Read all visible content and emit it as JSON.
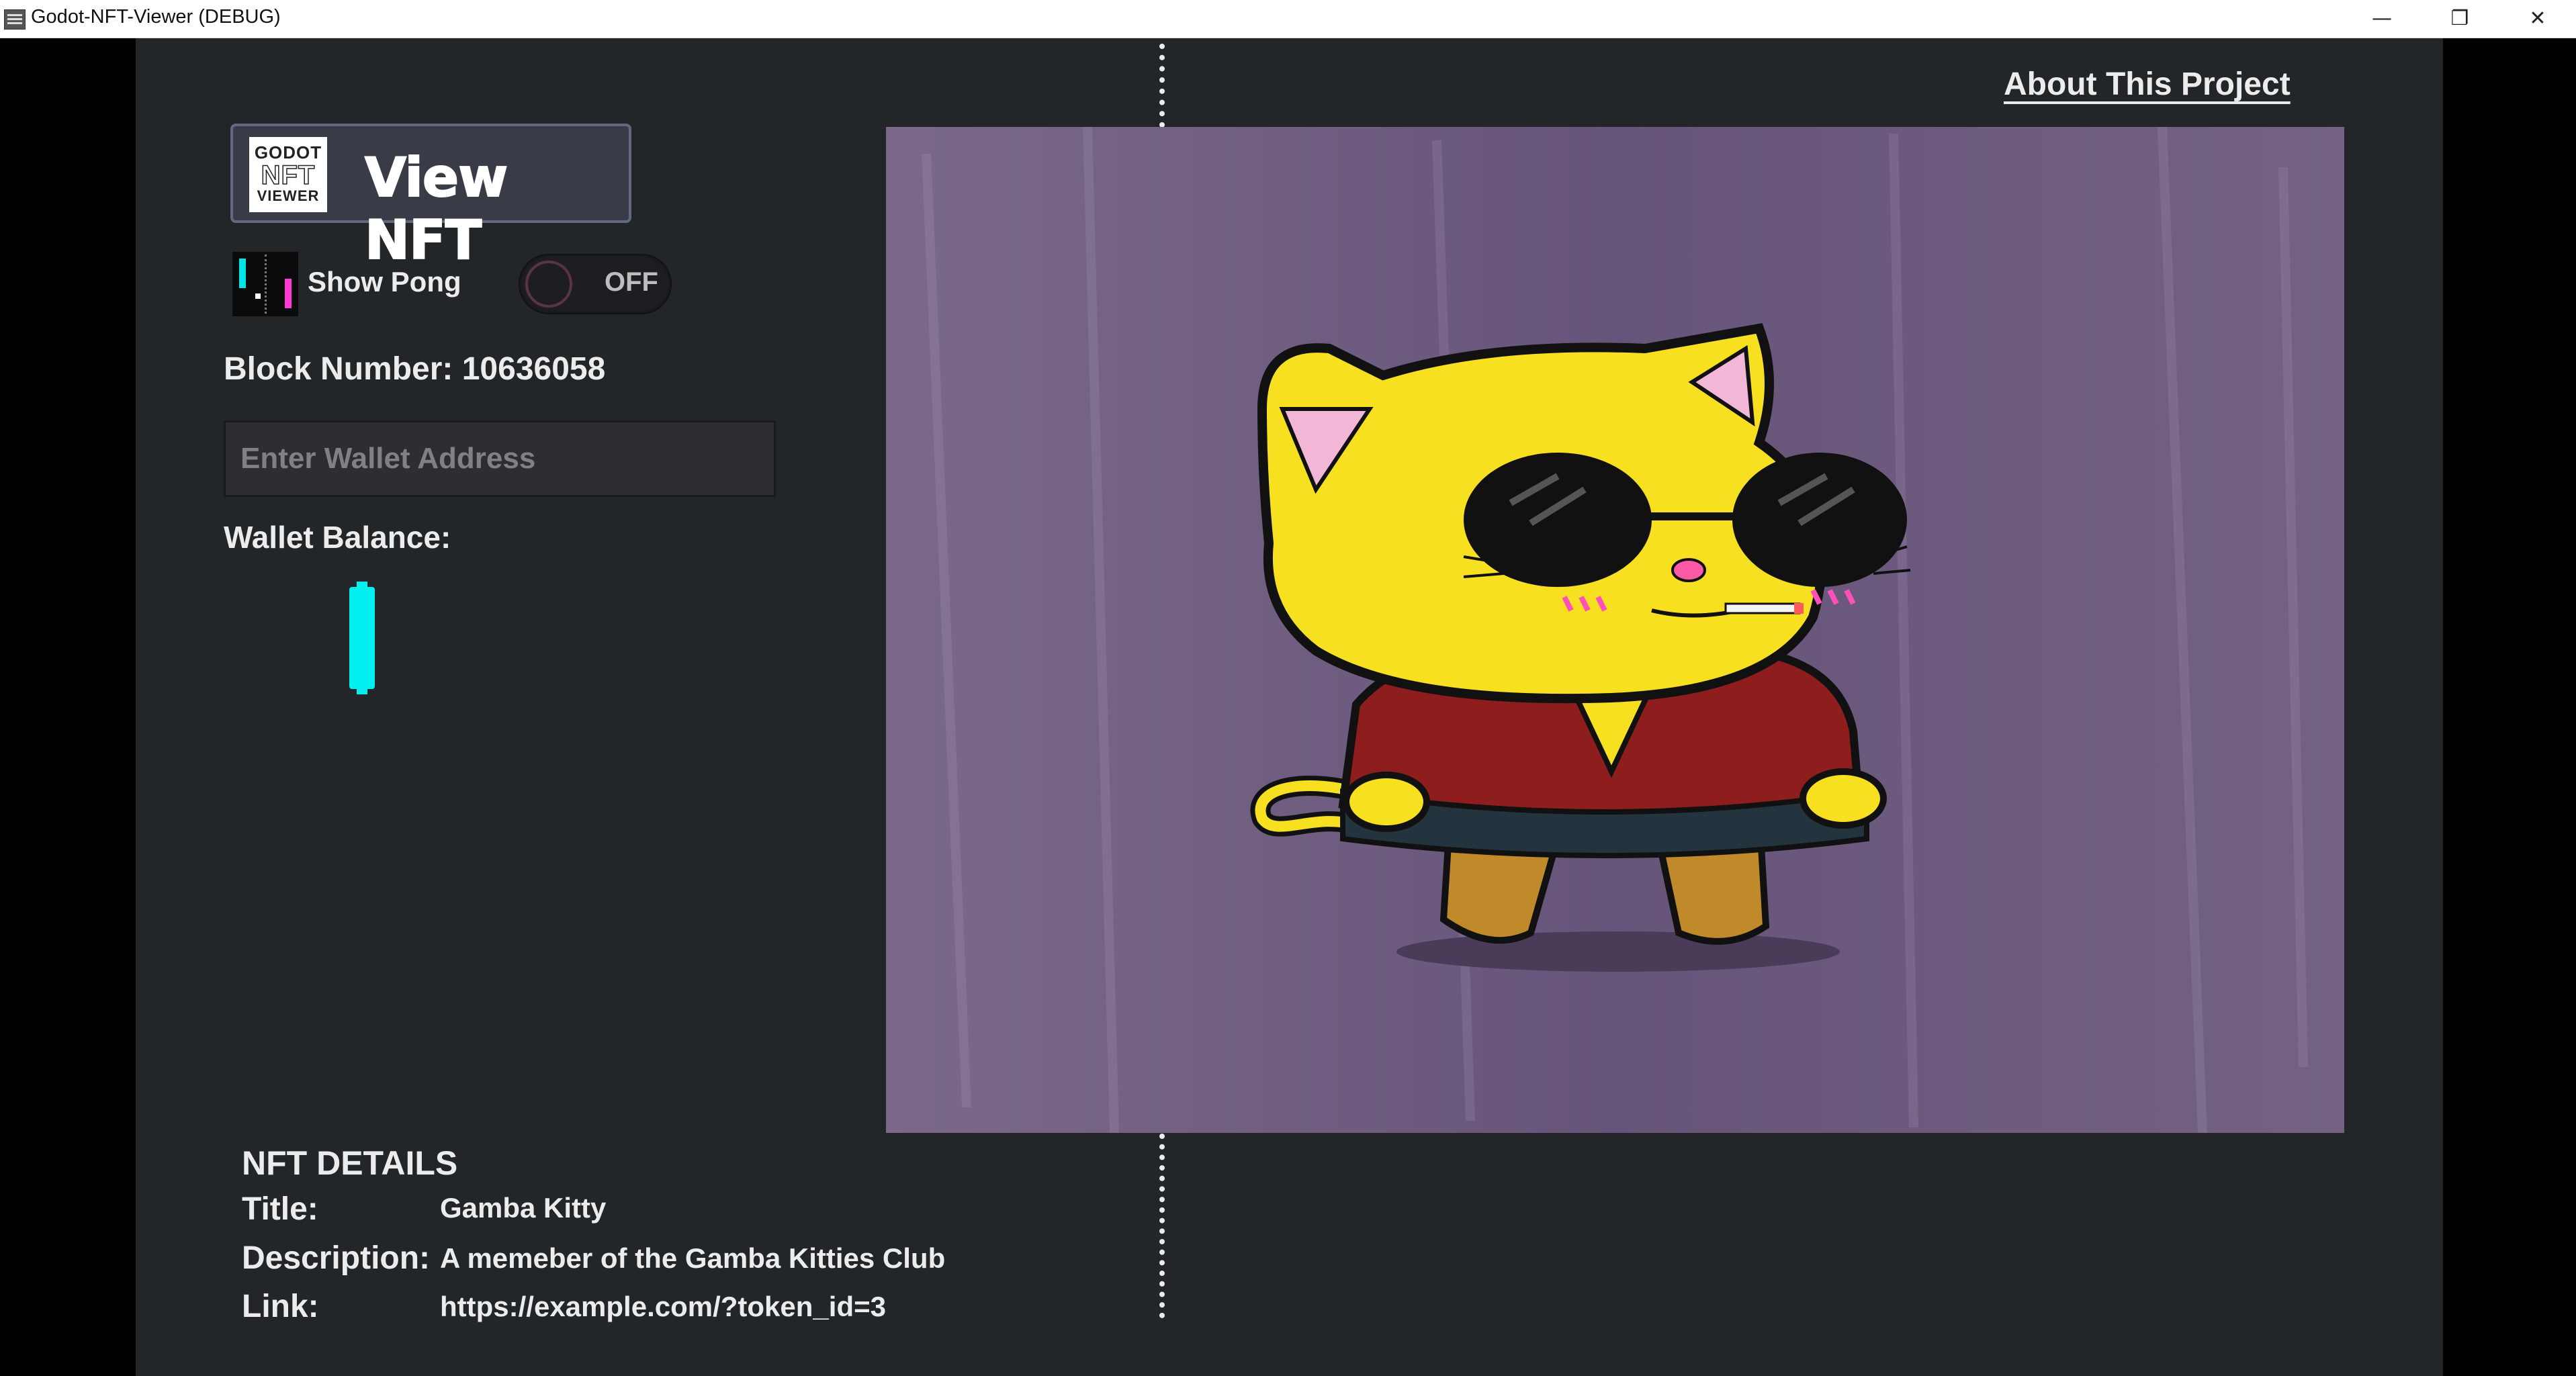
{
  "window": {
    "title": "Godot-NFT-Viewer (DEBUG)",
    "minimize": "—",
    "restore": "❐",
    "close": "✕"
  },
  "header": {
    "about_link": "About This Project"
  },
  "controls": {
    "view_button_label": "View NFT",
    "logo_lines": [
      "GODOT",
      "NFT",
      "VIEWER"
    ],
    "show_pong_label": "Show Pong",
    "toggle_state": "OFF",
    "block_number": "Block Number: 10636058",
    "wallet_placeholder": "Enter Wallet Address",
    "wallet_value": "",
    "wallet_balance_label": "Wallet Balance:"
  },
  "details": {
    "heading": "NFT DETAILS",
    "title_label": "Title:",
    "title_value": "Gamba Kitty",
    "description_label": "Description:",
    "description_value": "A memeber of the Gamba Kitties Club",
    "link_label": "Link:",
    "link_value": "https://example.com/?token_id=3"
  },
  "colors": {
    "app_bg": "#232629",
    "accent_cyan": "#00f0f0",
    "accent_magenta": "#ff3cd2",
    "nft_bg": "#6d5b7c"
  }
}
